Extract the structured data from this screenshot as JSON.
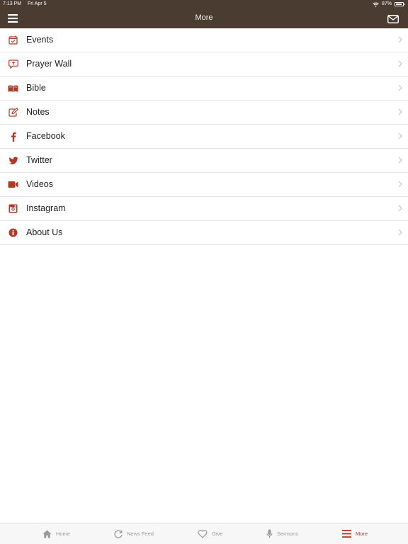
{
  "status": {
    "time": "7:13 PM",
    "date": "Fri Apr 5",
    "battery": "87%",
    "battery_level": 0.87
  },
  "header": {
    "title": "More",
    "menu_icon": "hamburger-menu-icon",
    "mail_icon": "envelope-icon"
  },
  "menu": {
    "items": [
      {
        "label": "Events",
        "icon": "calendar-icon"
      },
      {
        "label": "Prayer Wall",
        "icon": "prayer-bubble-icon"
      },
      {
        "label": "Bible",
        "icon": "open-book-icon"
      },
      {
        "label": "Notes",
        "icon": "edit-note-icon"
      },
      {
        "label": "Facebook",
        "icon": "facebook-icon"
      },
      {
        "label": "Twitter",
        "icon": "twitter-icon"
      },
      {
        "label": "Videos",
        "icon": "video-camera-icon"
      },
      {
        "label": "Instagram",
        "icon": "instagram-icon"
      },
      {
        "label": "About Us",
        "icon": "info-icon"
      }
    ]
  },
  "tabs": [
    {
      "label": "Home",
      "icon": "home-icon"
    },
    {
      "label": "News Feed",
      "icon": "refresh-icon"
    },
    {
      "label": "Give",
      "icon": "heart-icon"
    },
    {
      "label": "Sermons",
      "icon": "microphone-icon"
    },
    {
      "label": "More",
      "icon": "menu-lines-icon",
      "active": true
    }
  ],
  "colors": {
    "header_bg": "#4a3c31",
    "accent": "#b23a25",
    "tab_inactive": "#9a9a9a"
  }
}
